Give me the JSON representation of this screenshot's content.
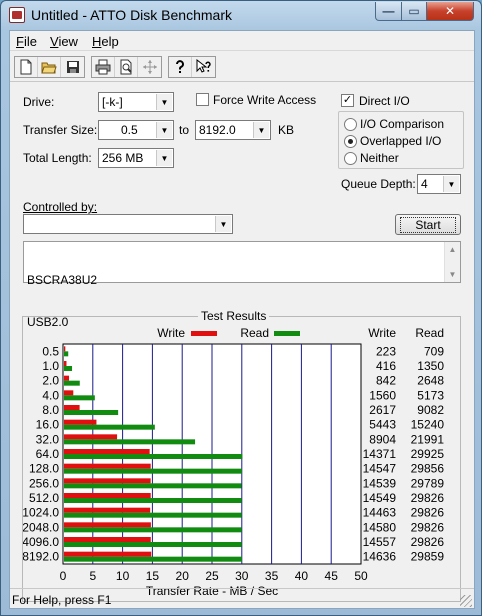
{
  "window": {
    "title": "Untitled - ATTO Disk Benchmark",
    "min_glyph": "—",
    "max_glyph": "▭",
    "close_glyph": "✕"
  },
  "menu": [
    {
      "first": "F",
      "rest": "ile"
    },
    {
      "first": "V",
      "rest": "iew"
    },
    {
      "first": "H",
      "rest": "elp"
    }
  ],
  "toolbar": {
    "icons": [
      "new-file-icon",
      "open-folder-icon",
      "save-icon",
      "print-icon",
      "print-preview-icon",
      "move-icon",
      "help-icon",
      "context-help-icon"
    ]
  },
  "form": {
    "drive_label": "Drive:",
    "drive_value": "[-k-]",
    "force_write_label": "Force Write Access",
    "force_write_checked": false,
    "direct_io_label": "Direct I/O",
    "direct_io_checked": true,
    "transfer_size_label": "Transfer Size:",
    "transfer_from": "0.5",
    "to_label": "to",
    "transfer_to": "8192.0",
    "transfer_unit": "KB",
    "total_length_label": "Total Length:",
    "total_length_value": "256 MB",
    "io_options": [
      {
        "label": "I/O Comparison",
        "checked": false
      },
      {
        "label": "Overlapped I/O",
        "checked": true
      },
      {
        "label": "Neither",
        "checked": false
      }
    ],
    "queue_depth_label": "Queue Depth:",
    "queue_depth_value": "4",
    "controlled_by_label": "Controlled by:",
    "controlled_by_value": "",
    "start_label": "Start",
    "description_line1": "BSCRA38U2",
    "description_line2": "USB2.0"
  },
  "status": {
    "text": "For Help, press F1"
  },
  "chart_data": {
    "type": "bar",
    "title": "Test Results",
    "orientation": "horizontal",
    "xlabel": "Transfer Rate - MB / Sec",
    "xlim": [
      0,
      50
    ],
    "xticks": [
      0,
      5,
      10,
      15,
      20,
      25,
      30,
      35,
      40,
      45,
      50
    ],
    "grid": true,
    "legend": [
      {
        "name": "Write",
        "color": "#e01010"
      },
      {
        "name": "Read",
        "color": "#118c11"
      }
    ],
    "column_headers": {
      "write": "Write",
      "read": "Read"
    },
    "categories": [
      "0.5",
      "1.0",
      "2.0",
      "4.0",
      "8.0",
      "16.0",
      "32.0",
      "64.0",
      "128.0",
      "256.0",
      "512.0",
      "1024.0",
      "2048.0",
      "4096.0",
      "8192.0"
    ],
    "series": [
      {
        "name": "Write",
        "values": [
          223,
          416,
          842,
          1560,
          2617,
          5443,
          8904,
          14371,
          14547,
          14539,
          14549,
          14463,
          14580,
          14557,
          14636
        ]
      },
      {
        "name": "Read",
        "values": [
          709,
          1350,
          2648,
          5173,
          9082,
          15240,
          21991,
          29925,
          29856,
          29789,
          29826,
          29826,
          29826,
          29826,
          29859
        ]
      }
    ],
    "value_unit_divisor": 1000
  }
}
